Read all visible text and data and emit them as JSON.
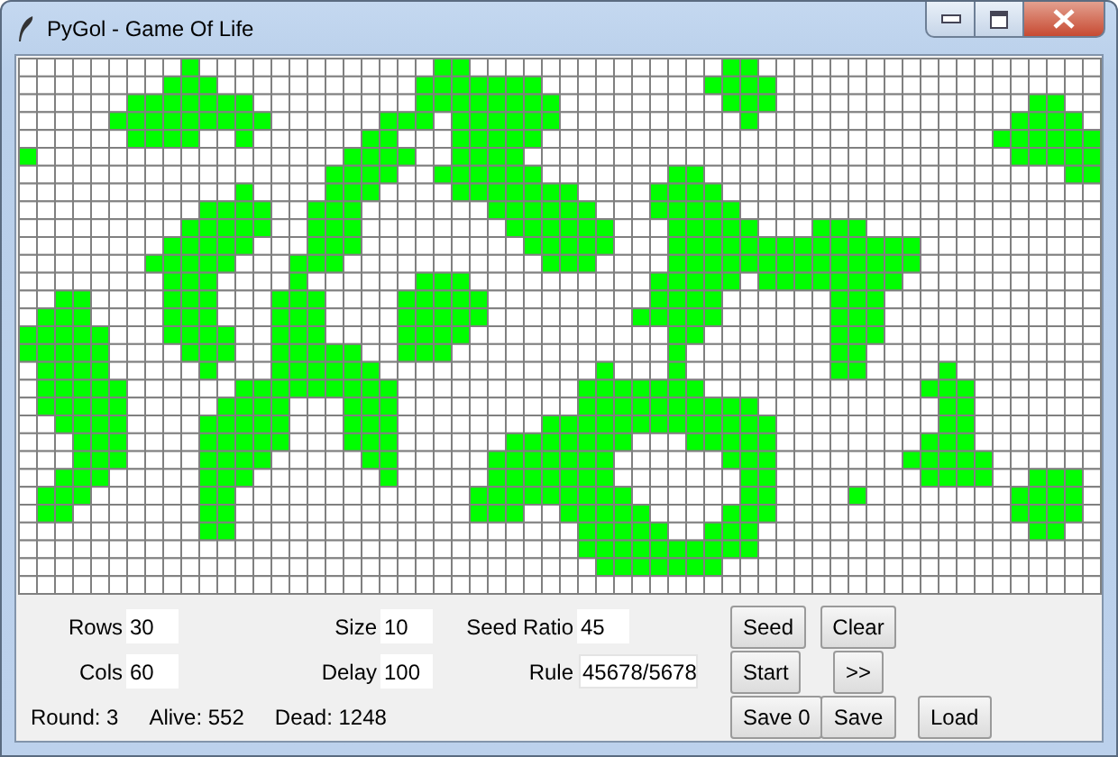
{
  "window": {
    "title": "PyGol - Game Of Life"
  },
  "board": [
    [
      false,
      false,
      false,
      false,
      false,
      false,
      false,
      false,
      false,
      true,
      false,
      false,
      false,
      false,
      false,
      false,
      false,
      false,
      false,
      false,
      false,
      false,
      false,
      true,
      true,
      false,
      false,
      false,
      false,
      false,
      false,
      false,
      false,
      false,
      false,
      false,
      false,
      false,
      false,
      true,
      true,
      false,
      false,
      false,
      false,
      false,
      false,
      false,
      false,
      false,
      false,
      false,
      false,
      false,
      false,
      false,
      false,
      false,
      false,
      false
    ],
    [
      false,
      false,
      false,
      false,
      false,
      false,
      false,
      false,
      true,
      true,
      true,
      false,
      false,
      false,
      false,
      false,
      false,
      false,
      false,
      false,
      false,
      false,
      true,
      true,
      true,
      true,
      true,
      true,
      true,
      false,
      false,
      false,
      false,
      false,
      false,
      false,
      false,
      false,
      true,
      true,
      true,
      true,
      false,
      false,
      false,
      false,
      false,
      false,
      false,
      false,
      false,
      false,
      false,
      false,
      false,
      false,
      false,
      false,
      false,
      false
    ],
    [
      false,
      false,
      false,
      false,
      false,
      false,
      true,
      true,
      true,
      true,
      true,
      true,
      true,
      false,
      false,
      false,
      false,
      false,
      false,
      false,
      false,
      false,
      true,
      true,
      true,
      true,
      true,
      true,
      true,
      true,
      false,
      false,
      false,
      false,
      false,
      false,
      false,
      false,
      false,
      true,
      true,
      true,
      false,
      false,
      false,
      false,
      false,
      false,
      false,
      false,
      false,
      false,
      false,
      false,
      false,
      false,
      true,
      true,
      false,
      false
    ],
    [
      false,
      false,
      false,
      false,
      false,
      true,
      true,
      true,
      true,
      true,
      true,
      true,
      true,
      true,
      false,
      false,
      false,
      false,
      false,
      false,
      true,
      true,
      true,
      false,
      true,
      true,
      true,
      true,
      true,
      true,
      false,
      false,
      false,
      false,
      false,
      false,
      false,
      false,
      false,
      false,
      true,
      false,
      false,
      false,
      false,
      false,
      false,
      false,
      false,
      false,
      false,
      false,
      false,
      false,
      false,
      true,
      true,
      true,
      true,
      false
    ],
    [
      false,
      false,
      false,
      false,
      false,
      false,
      true,
      true,
      true,
      true,
      false,
      false,
      true,
      false,
      false,
      false,
      false,
      false,
      false,
      true,
      true,
      false,
      false,
      false,
      true,
      true,
      true,
      true,
      true,
      false,
      false,
      false,
      false,
      false,
      false,
      false,
      false,
      false,
      false,
      false,
      false,
      false,
      false,
      false,
      false,
      false,
      false,
      false,
      false,
      false,
      false,
      false,
      false,
      false,
      true,
      true,
      true,
      true,
      true,
      true
    ],
    [
      true,
      false,
      false,
      false,
      false,
      false,
      false,
      false,
      false,
      false,
      false,
      false,
      false,
      false,
      false,
      false,
      false,
      false,
      true,
      true,
      true,
      true,
      false,
      false,
      true,
      true,
      true,
      true,
      false,
      false,
      false,
      false,
      false,
      false,
      false,
      false,
      false,
      false,
      false,
      false,
      false,
      false,
      false,
      false,
      false,
      false,
      false,
      false,
      false,
      false,
      false,
      false,
      false,
      false,
      false,
      true,
      true,
      true,
      true,
      true
    ],
    [
      false,
      false,
      false,
      false,
      false,
      false,
      false,
      false,
      false,
      false,
      false,
      false,
      false,
      false,
      false,
      false,
      false,
      true,
      true,
      true,
      true,
      false,
      false,
      true,
      true,
      true,
      true,
      true,
      true,
      false,
      false,
      false,
      false,
      false,
      false,
      false,
      true,
      true,
      false,
      false,
      false,
      false,
      false,
      false,
      false,
      false,
      false,
      false,
      false,
      false,
      false,
      false,
      false,
      false,
      false,
      false,
      false,
      false,
      true,
      true
    ],
    [
      false,
      false,
      false,
      false,
      false,
      false,
      false,
      false,
      false,
      false,
      false,
      false,
      true,
      false,
      false,
      false,
      false,
      true,
      true,
      true,
      false,
      false,
      false,
      false,
      true,
      true,
      true,
      true,
      true,
      true,
      true,
      false,
      false,
      false,
      false,
      true,
      true,
      true,
      true,
      false,
      false,
      false,
      false,
      false,
      false,
      false,
      false,
      false,
      false,
      false,
      false,
      false,
      false,
      false,
      false,
      false,
      false,
      false,
      false,
      false
    ],
    [
      false,
      false,
      false,
      false,
      false,
      false,
      false,
      false,
      false,
      false,
      true,
      true,
      true,
      true,
      false,
      false,
      true,
      true,
      true,
      false,
      false,
      false,
      false,
      false,
      false,
      false,
      true,
      true,
      true,
      true,
      true,
      true,
      false,
      false,
      false,
      true,
      true,
      true,
      true,
      true,
      false,
      false,
      false,
      false,
      false,
      false,
      false,
      false,
      false,
      false,
      false,
      false,
      false,
      false,
      false,
      false,
      false,
      false,
      false,
      false
    ],
    [
      false,
      false,
      false,
      false,
      false,
      false,
      false,
      false,
      false,
      true,
      true,
      true,
      true,
      true,
      false,
      false,
      true,
      true,
      true,
      false,
      false,
      false,
      false,
      false,
      false,
      false,
      false,
      true,
      true,
      true,
      true,
      true,
      true,
      false,
      false,
      false,
      true,
      true,
      true,
      true,
      true,
      false,
      false,
      false,
      true,
      true,
      true,
      false,
      false,
      false,
      false,
      false,
      false,
      false,
      false,
      false,
      false,
      false,
      false,
      false
    ],
    [
      false,
      false,
      false,
      false,
      false,
      false,
      false,
      false,
      true,
      true,
      true,
      true,
      true,
      false,
      false,
      false,
      true,
      true,
      true,
      false,
      false,
      false,
      false,
      false,
      false,
      false,
      false,
      false,
      true,
      true,
      true,
      true,
      true,
      false,
      false,
      false,
      true,
      true,
      true,
      true,
      true,
      true,
      true,
      true,
      true,
      true,
      true,
      true,
      true,
      true,
      false,
      false,
      false,
      false,
      false,
      false,
      false,
      false,
      false,
      false
    ],
    [
      false,
      false,
      false,
      false,
      false,
      false,
      false,
      true,
      true,
      true,
      true,
      true,
      false,
      false,
      false,
      true,
      true,
      true,
      false,
      false,
      false,
      false,
      false,
      false,
      false,
      false,
      false,
      false,
      false,
      true,
      true,
      true,
      false,
      false,
      false,
      false,
      true,
      true,
      true,
      true,
      true,
      true,
      true,
      true,
      true,
      true,
      true,
      true,
      true,
      true,
      false,
      false,
      false,
      false,
      false,
      false,
      false,
      false,
      false,
      false
    ],
    [
      false,
      false,
      false,
      false,
      false,
      false,
      false,
      false,
      true,
      true,
      true,
      false,
      false,
      false,
      false,
      true,
      false,
      false,
      false,
      false,
      false,
      false,
      true,
      true,
      true,
      false,
      false,
      false,
      false,
      false,
      false,
      false,
      false,
      false,
      false,
      true,
      true,
      true,
      true,
      true,
      false,
      true,
      true,
      true,
      true,
      true,
      true,
      true,
      true,
      false,
      false,
      false,
      false,
      false,
      false,
      false,
      false,
      false,
      false,
      false
    ],
    [
      false,
      false,
      true,
      true,
      false,
      false,
      false,
      false,
      true,
      true,
      true,
      false,
      false,
      false,
      true,
      true,
      true,
      false,
      false,
      false,
      false,
      true,
      true,
      true,
      true,
      true,
      false,
      false,
      false,
      false,
      false,
      false,
      false,
      false,
      false,
      true,
      true,
      true,
      true,
      false,
      false,
      false,
      false,
      false,
      false,
      true,
      true,
      true,
      false,
      false,
      false,
      false,
      false,
      false,
      false,
      false,
      false,
      false,
      false,
      false
    ],
    [
      false,
      true,
      true,
      true,
      false,
      false,
      false,
      false,
      true,
      true,
      true,
      false,
      false,
      false,
      true,
      true,
      true,
      false,
      false,
      false,
      false,
      true,
      true,
      true,
      true,
      true,
      false,
      false,
      false,
      false,
      false,
      false,
      false,
      false,
      true,
      true,
      true,
      true,
      true,
      false,
      false,
      false,
      false,
      false,
      false,
      true,
      true,
      true,
      false,
      false,
      false,
      false,
      false,
      false,
      false,
      false,
      false,
      false,
      false,
      false
    ],
    [
      true,
      true,
      true,
      true,
      true,
      false,
      false,
      false,
      true,
      true,
      true,
      true,
      false,
      false,
      true,
      true,
      true,
      false,
      false,
      false,
      false,
      true,
      true,
      true,
      true,
      false,
      false,
      false,
      false,
      false,
      false,
      false,
      false,
      false,
      false,
      false,
      true,
      true,
      false,
      false,
      false,
      false,
      false,
      false,
      false,
      true,
      true,
      true,
      false,
      false,
      false,
      false,
      false,
      false,
      false,
      false,
      false,
      false,
      false,
      false
    ],
    [
      true,
      true,
      true,
      true,
      true,
      false,
      false,
      false,
      false,
      true,
      true,
      true,
      false,
      false,
      true,
      true,
      true,
      true,
      true,
      false,
      false,
      true,
      true,
      true,
      false,
      false,
      false,
      false,
      false,
      false,
      false,
      false,
      false,
      false,
      false,
      false,
      true,
      false,
      false,
      false,
      false,
      false,
      false,
      false,
      false,
      true,
      true,
      false,
      false,
      false,
      false,
      false,
      false,
      false,
      false,
      false,
      false,
      false,
      false,
      false
    ],
    [
      false,
      true,
      true,
      true,
      true,
      false,
      false,
      false,
      false,
      false,
      true,
      false,
      false,
      false,
      true,
      true,
      true,
      true,
      true,
      true,
      false,
      false,
      false,
      false,
      false,
      false,
      false,
      false,
      false,
      false,
      false,
      false,
      true,
      false,
      false,
      false,
      true,
      false,
      false,
      false,
      false,
      false,
      false,
      false,
      false,
      true,
      true,
      false,
      false,
      false,
      false,
      true,
      false,
      false,
      false,
      false,
      false,
      false,
      false,
      false
    ],
    [
      false,
      true,
      true,
      true,
      true,
      true,
      false,
      false,
      false,
      false,
      false,
      false,
      true,
      true,
      true,
      true,
      true,
      true,
      true,
      true,
      true,
      false,
      false,
      false,
      false,
      false,
      false,
      false,
      false,
      false,
      false,
      true,
      true,
      true,
      true,
      true,
      true,
      true,
      false,
      false,
      false,
      false,
      false,
      false,
      false,
      false,
      false,
      false,
      false,
      false,
      true,
      true,
      true,
      false,
      false,
      false,
      false,
      false,
      false,
      false
    ],
    [
      false,
      true,
      true,
      true,
      true,
      true,
      false,
      false,
      false,
      false,
      false,
      true,
      true,
      true,
      true,
      false,
      false,
      false,
      true,
      true,
      true,
      false,
      false,
      false,
      false,
      false,
      false,
      false,
      false,
      false,
      false,
      true,
      true,
      true,
      true,
      true,
      true,
      true,
      true,
      true,
      true,
      false,
      false,
      false,
      false,
      false,
      false,
      false,
      false,
      false,
      false,
      true,
      true,
      false,
      false,
      false,
      false,
      false,
      false,
      false
    ],
    [
      false,
      false,
      true,
      true,
      true,
      true,
      false,
      false,
      false,
      false,
      true,
      true,
      true,
      true,
      true,
      false,
      false,
      false,
      true,
      true,
      true,
      false,
      false,
      false,
      false,
      false,
      false,
      false,
      false,
      true,
      true,
      true,
      true,
      true,
      true,
      true,
      true,
      true,
      true,
      true,
      true,
      true,
      false,
      false,
      false,
      false,
      false,
      false,
      false,
      false,
      false,
      true,
      true,
      false,
      false,
      false,
      false,
      false,
      false,
      false
    ],
    [
      false,
      false,
      false,
      true,
      true,
      true,
      false,
      false,
      false,
      false,
      true,
      true,
      true,
      true,
      true,
      false,
      false,
      false,
      true,
      true,
      true,
      false,
      false,
      false,
      false,
      false,
      false,
      true,
      true,
      true,
      true,
      true,
      true,
      true,
      false,
      false,
      false,
      true,
      true,
      true,
      true,
      true,
      false,
      false,
      false,
      false,
      false,
      false,
      false,
      false,
      true,
      true,
      true,
      false,
      false,
      false,
      false,
      false,
      false,
      false
    ],
    [
      false,
      false,
      false,
      true,
      true,
      true,
      false,
      false,
      false,
      false,
      true,
      true,
      true,
      true,
      false,
      false,
      false,
      false,
      false,
      true,
      true,
      false,
      false,
      false,
      false,
      false,
      true,
      true,
      true,
      true,
      true,
      true,
      true,
      false,
      false,
      false,
      false,
      false,
      false,
      true,
      true,
      true,
      false,
      false,
      false,
      false,
      false,
      false,
      false,
      true,
      true,
      true,
      true,
      true,
      false,
      false,
      false,
      false,
      false,
      false
    ],
    [
      false,
      false,
      true,
      true,
      true,
      false,
      false,
      false,
      false,
      false,
      true,
      true,
      true,
      false,
      false,
      false,
      false,
      false,
      false,
      false,
      true,
      false,
      false,
      false,
      false,
      false,
      true,
      true,
      true,
      true,
      true,
      true,
      true,
      false,
      false,
      false,
      false,
      false,
      false,
      false,
      true,
      true,
      false,
      false,
      false,
      false,
      false,
      false,
      false,
      false,
      true,
      true,
      true,
      true,
      false,
      false,
      true,
      true,
      true,
      false
    ],
    [
      false,
      true,
      true,
      true,
      false,
      false,
      false,
      false,
      false,
      false,
      true,
      true,
      false,
      false,
      false,
      false,
      false,
      false,
      false,
      false,
      false,
      false,
      false,
      false,
      false,
      true,
      true,
      true,
      true,
      true,
      true,
      true,
      true,
      true,
      false,
      false,
      false,
      false,
      false,
      false,
      true,
      true,
      false,
      false,
      false,
      false,
      true,
      false,
      false,
      false,
      false,
      false,
      false,
      false,
      false,
      true,
      true,
      true,
      true,
      false
    ],
    [
      false,
      true,
      true,
      false,
      false,
      false,
      false,
      false,
      false,
      false,
      true,
      true,
      false,
      false,
      false,
      false,
      false,
      false,
      false,
      false,
      false,
      false,
      false,
      false,
      false,
      true,
      true,
      true,
      false,
      false,
      true,
      true,
      true,
      true,
      true,
      false,
      false,
      false,
      false,
      true,
      true,
      true,
      false,
      false,
      false,
      false,
      false,
      false,
      false,
      false,
      false,
      false,
      false,
      false,
      false,
      true,
      true,
      true,
      true,
      false
    ],
    [
      false,
      false,
      false,
      false,
      false,
      false,
      false,
      false,
      false,
      false,
      true,
      true,
      false,
      false,
      false,
      false,
      false,
      false,
      false,
      false,
      false,
      false,
      false,
      false,
      false,
      false,
      false,
      false,
      false,
      false,
      false,
      true,
      true,
      true,
      true,
      true,
      false,
      false,
      true,
      true,
      true,
      false,
      false,
      false,
      false,
      false,
      false,
      false,
      false,
      false,
      false,
      false,
      false,
      false,
      false,
      false,
      true,
      true,
      false,
      false
    ],
    [
      false,
      false,
      false,
      false,
      false,
      false,
      false,
      false,
      false,
      false,
      false,
      false,
      false,
      false,
      false,
      false,
      false,
      false,
      false,
      false,
      false,
      false,
      false,
      false,
      false,
      false,
      false,
      false,
      false,
      false,
      false,
      true,
      true,
      true,
      true,
      true,
      true,
      true,
      true,
      true,
      true,
      false,
      false,
      false,
      false,
      false,
      false,
      false,
      false,
      false,
      false,
      false,
      false,
      false,
      false,
      false,
      false,
      false,
      false,
      false
    ],
    [
      false,
      false,
      false,
      false,
      false,
      false,
      false,
      false,
      false,
      false,
      false,
      false,
      false,
      false,
      false,
      false,
      false,
      false,
      false,
      false,
      false,
      false,
      false,
      false,
      false,
      false,
      false,
      false,
      false,
      false,
      false,
      false,
      true,
      true,
      true,
      true,
      true,
      true,
      true,
      false,
      false,
      false,
      false,
      false,
      false,
      false,
      false,
      false,
      false,
      false,
      false,
      false,
      false,
      false,
      false,
      false,
      false,
      false,
      false,
      false
    ],
    [
      false,
      false,
      false,
      false,
      false,
      false,
      false,
      false,
      false,
      false,
      false,
      false,
      false,
      false,
      false,
      false,
      false,
      false,
      false,
      false,
      false,
      false,
      false,
      false,
      false,
      false,
      false,
      false,
      false,
      false,
      false,
      false,
      false,
      false,
      false,
      false,
      false,
      false,
      false,
      false,
      false,
      false,
      false,
      false,
      false,
      false,
      false,
      false,
      false,
      false,
      false,
      false,
      false,
      false,
      false,
      false,
      false,
      false,
      false,
      false
    ]
  ],
  "fields": [
    {
      "label": "Rows",
      "value": "30",
      "focused": false
    },
    {
      "label": "Size",
      "value": "10",
      "focused": false
    },
    {
      "label": "Seed Ratio",
      "value": "45",
      "focused": false
    },
    {
      "label": "Cols",
      "value": "60",
      "focused": false
    },
    {
      "label": "Delay",
      "value": "100",
      "focused": false
    },
    {
      "label": "Rule",
      "value": "45678/5678",
      "focused": true
    }
  ],
  "buttons": [
    "Seed",
    "Clear",
    "Start",
    ">>",
    "Save 0",
    "Save",
    "Load"
  ],
  "status": [
    "Round: 3",
    "Alive: 552",
    "Dead: 1248"
  ]
}
